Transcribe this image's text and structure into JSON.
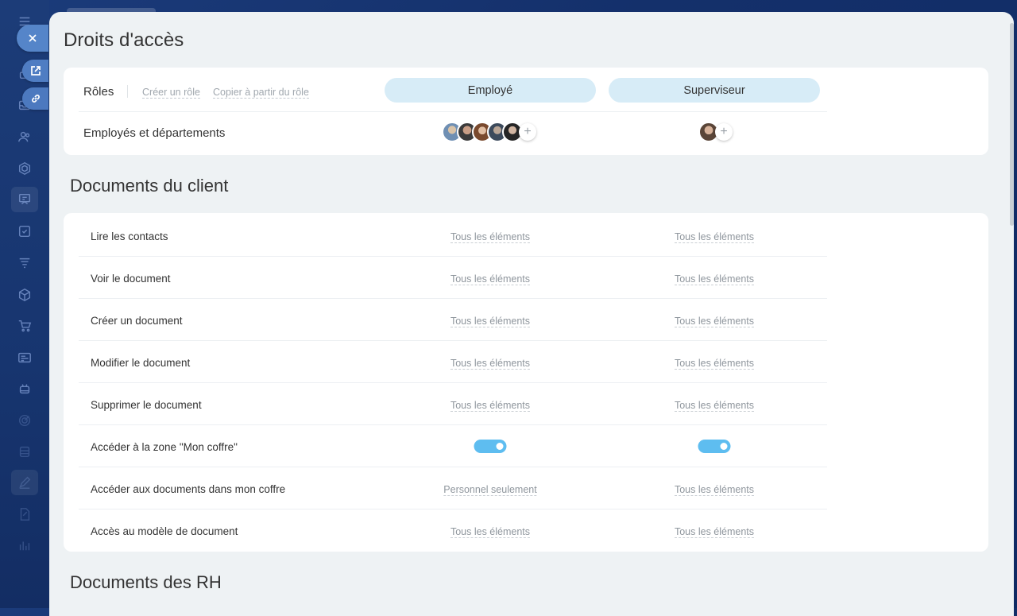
{
  "panel": {
    "title": "Droits d'accès"
  },
  "roles": {
    "label": "Rôles",
    "create_link": "Créer un rôle",
    "copy_link": "Copier à partir du rôle",
    "columns": [
      {
        "name": "Employé"
      },
      {
        "name": "Superviseur"
      }
    ],
    "members_label": "Employés et départements",
    "add_symbol": "+"
  },
  "section_client": {
    "title": "Documents du client",
    "rows": [
      {
        "label": "Lire les contacts",
        "values": [
          "Tous les éléments",
          "Tous les éléments"
        ]
      },
      {
        "label": "Voir le document",
        "values": [
          "Tous les éléments",
          "Tous les éléments"
        ]
      },
      {
        "label": "Créer un document",
        "values": [
          "Tous les éléments",
          "Tous les éléments"
        ]
      },
      {
        "label": "Modifier le document",
        "values": [
          "Tous les éléments",
          "Tous les éléments"
        ]
      },
      {
        "label": "Supprimer le document",
        "values": [
          "Tous les éléments",
          "Tous les éléments"
        ]
      },
      {
        "label": "Accéder à la zone \"Mon coffre\"",
        "toggles": [
          true,
          true
        ]
      },
      {
        "label": "Accéder aux documents dans mon coffre",
        "values": [
          "Personnel seulement",
          "Tous les éléments"
        ]
      },
      {
        "label": "Accès au modèle de document",
        "values": [
          "Tous les éléments",
          "Tous les éléments"
        ]
      }
    ]
  },
  "section_hr": {
    "title": "Documents des RH"
  },
  "colors": {
    "accent_toggle": "#5ebdf0",
    "role_pill": "#d7ecf7",
    "panel_bg": "#eef2f4"
  }
}
